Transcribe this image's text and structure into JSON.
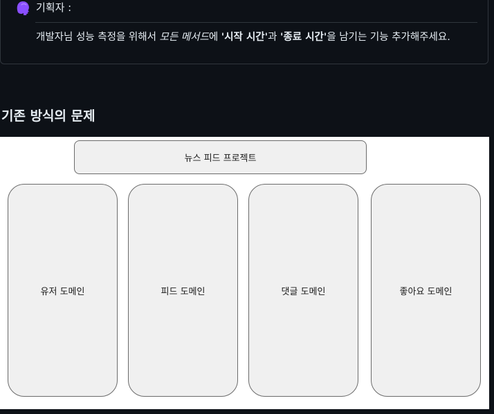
{
  "callout": {
    "speaker": "기획자 :",
    "message": {
      "part1": "개발자님 성능 측정을 위해서 ",
      "emphasis": "모든 메서드",
      "part2": "에 ",
      "strong1": "'시작 시간'",
      "part3": "과 ",
      "strong2": "'종료 시간'",
      "part4": "을 남기는 기능 추가해주세요."
    }
  },
  "section": {
    "heading": "기존 방식의 문제"
  },
  "diagram": {
    "project": "뉴스 피드 프로젝트",
    "domains": [
      "유저 도메인",
      "피드 도메인",
      "댓글 도메인",
      "좋아요 도메인"
    ]
  },
  "colors": {
    "page_background": "#0d1117",
    "text": "#e6edf3",
    "border": "#30363d",
    "diagram_background": "#ffffff",
    "box_fill": "#f0f0f0",
    "box_stroke": "#6b6b6b",
    "avatar": "#8a4fff"
  },
  "icons": {
    "avatar": "person-head-silhouette-icon"
  }
}
